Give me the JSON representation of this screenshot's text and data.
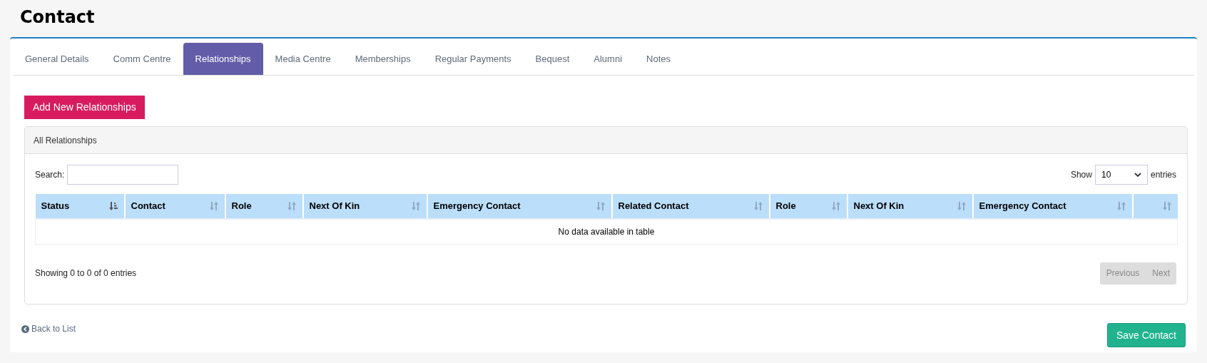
{
  "page": {
    "title": "Contact"
  },
  "tabs": [
    {
      "label": "General Details",
      "selected": false
    },
    {
      "label": "Comm Centre",
      "selected": false
    },
    {
      "label": "Relationships",
      "selected": true
    },
    {
      "label": "Media Centre",
      "selected": false
    },
    {
      "label": "Memberships",
      "selected": false
    },
    {
      "label": "Regular Payments",
      "selected": false
    },
    {
      "label": "Bequest",
      "selected": false
    },
    {
      "label": "Alumni",
      "selected": false
    },
    {
      "label": "Notes",
      "selected": false
    }
  ],
  "add_button": "Add New Relationships",
  "panel": {
    "title": "All Relationships",
    "search": {
      "label": "Search:"
    },
    "length": {
      "label_before": "Show",
      "value": "10",
      "label_after": "entries"
    },
    "table": {
      "columns": [
        {
          "label": "Status",
          "sorted": true
        },
        {
          "label": "Contact",
          "sorted": false
        },
        {
          "label": "Role",
          "sorted": false
        },
        {
          "label": "Next Of Kin",
          "sorted": false
        },
        {
          "label": "Emergency Contact",
          "sorted": false
        },
        {
          "label": "Related Contact",
          "sorted": false
        },
        {
          "label": "Role",
          "sorted": false
        },
        {
          "label": "Next Of Kin",
          "sorted": false
        },
        {
          "label": "Emergency Contact",
          "sorted": false
        },
        {
          "sorted": false
        }
      ],
      "empty_message": "No data available in table"
    },
    "info": "Showing 0 to 0 of 0 entries",
    "pagination": [
      {
        "label": "Previous",
        "disabled": true
      },
      {
        "label": "Next",
        "disabled": true
      }
    ]
  },
  "back_link": "Back to List",
  "save_button": "Save Contact"
}
